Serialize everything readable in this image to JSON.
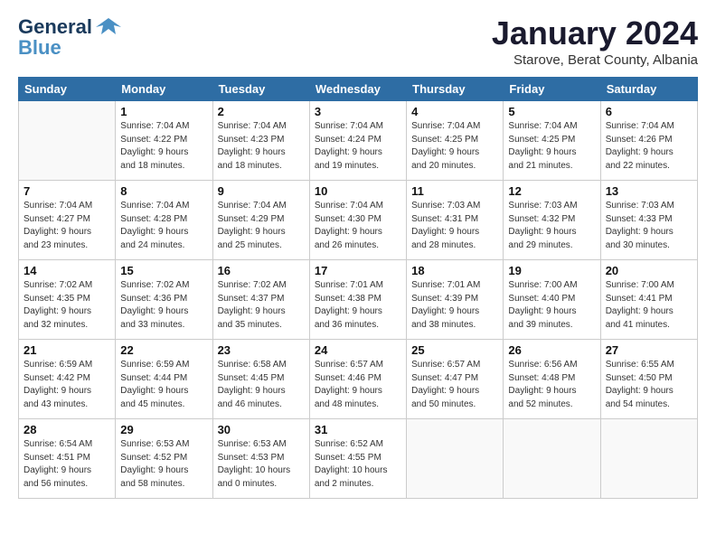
{
  "logo": {
    "line1": "General",
    "line2": "Blue"
  },
  "title": "January 2024",
  "subtitle": "Starove, Berat County, Albania",
  "weekdays": [
    "Sunday",
    "Monday",
    "Tuesday",
    "Wednesday",
    "Thursday",
    "Friday",
    "Saturday"
  ],
  "weeks": [
    [
      {
        "day": "",
        "info": ""
      },
      {
        "day": "1",
        "info": "Sunrise: 7:04 AM\nSunset: 4:22 PM\nDaylight: 9 hours\nand 18 minutes."
      },
      {
        "day": "2",
        "info": "Sunrise: 7:04 AM\nSunset: 4:23 PM\nDaylight: 9 hours\nand 18 minutes."
      },
      {
        "day": "3",
        "info": "Sunrise: 7:04 AM\nSunset: 4:24 PM\nDaylight: 9 hours\nand 19 minutes."
      },
      {
        "day": "4",
        "info": "Sunrise: 7:04 AM\nSunset: 4:25 PM\nDaylight: 9 hours\nand 20 minutes."
      },
      {
        "day": "5",
        "info": "Sunrise: 7:04 AM\nSunset: 4:25 PM\nDaylight: 9 hours\nand 21 minutes."
      },
      {
        "day": "6",
        "info": "Sunrise: 7:04 AM\nSunset: 4:26 PM\nDaylight: 9 hours\nand 22 minutes."
      }
    ],
    [
      {
        "day": "7",
        "info": "Sunrise: 7:04 AM\nSunset: 4:27 PM\nDaylight: 9 hours\nand 23 minutes."
      },
      {
        "day": "8",
        "info": "Sunrise: 7:04 AM\nSunset: 4:28 PM\nDaylight: 9 hours\nand 24 minutes."
      },
      {
        "day": "9",
        "info": "Sunrise: 7:04 AM\nSunset: 4:29 PM\nDaylight: 9 hours\nand 25 minutes."
      },
      {
        "day": "10",
        "info": "Sunrise: 7:04 AM\nSunset: 4:30 PM\nDaylight: 9 hours\nand 26 minutes."
      },
      {
        "day": "11",
        "info": "Sunrise: 7:03 AM\nSunset: 4:31 PM\nDaylight: 9 hours\nand 28 minutes."
      },
      {
        "day": "12",
        "info": "Sunrise: 7:03 AM\nSunset: 4:32 PM\nDaylight: 9 hours\nand 29 minutes."
      },
      {
        "day": "13",
        "info": "Sunrise: 7:03 AM\nSunset: 4:33 PM\nDaylight: 9 hours\nand 30 minutes."
      }
    ],
    [
      {
        "day": "14",
        "info": "Sunrise: 7:02 AM\nSunset: 4:35 PM\nDaylight: 9 hours\nand 32 minutes."
      },
      {
        "day": "15",
        "info": "Sunrise: 7:02 AM\nSunset: 4:36 PM\nDaylight: 9 hours\nand 33 minutes."
      },
      {
        "day": "16",
        "info": "Sunrise: 7:02 AM\nSunset: 4:37 PM\nDaylight: 9 hours\nand 35 minutes."
      },
      {
        "day": "17",
        "info": "Sunrise: 7:01 AM\nSunset: 4:38 PM\nDaylight: 9 hours\nand 36 minutes."
      },
      {
        "day": "18",
        "info": "Sunrise: 7:01 AM\nSunset: 4:39 PM\nDaylight: 9 hours\nand 38 minutes."
      },
      {
        "day": "19",
        "info": "Sunrise: 7:00 AM\nSunset: 4:40 PM\nDaylight: 9 hours\nand 39 minutes."
      },
      {
        "day": "20",
        "info": "Sunrise: 7:00 AM\nSunset: 4:41 PM\nDaylight: 9 hours\nand 41 minutes."
      }
    ],
    [
      {
        "day": "21",
        "info": "Sunrise: 6:59 AM\nSunset: 4:42 PM\nDaylight: 9 hours\nand 43 minutes."
      },
      {
        "day": "22",
        "info": "Sunrise: 6:59 AM\nSunset: 4:44 PM\nDaylight: 9 hours\nand 45 minutes."
      },
      {
        "day": "23",
        "info": "Sunrise: 6:58 AM\nSunset: 4:45 PM\nDaylight: 9 hours\nand 46 minutes."
      },
      {
        "day": "24",
        "info": "Sunrise: 6:57 AM\nSunset: 4:46 PM\nDaylight: 9 hours\nand 48 minutes."
      },
      {
        "day": "25",
        "info": "Sunrise: 6:57 AM\nSunset: 4:47 PM\nDaylight: 9 hours\nand 50 minutes."
      },
      {
        "day": "26",
        "info": "Sunrise: 6:56 AM\nSunset: 4:48 PM\nDaylight: 9 hours\nand 52 minutes."
      },
      {
        "day": "27",
        "info": "Sunrise: 6:55 AM\nSunset: 4:50 PM\nDaylight: 9 hours\nand 54 minutes."
      }
    ],
    [
      {
        "day": "28",
        "info": "Sunrise: 6:54 AM\nSunset: 4:51 PM\nDaylight: 9 hours\nand 56 minutes."
      },
      {
        "day": "29",
        "info": "Sunrise: 6:53 AM\nSunset: 4:52 PM\nDaylight: 9 hours\nand 58 minutes."
      },
      {
        "day": "30",
        "info": "Sunrise: 6:53 AM\nSunset: 4:53 PM\nDaylight: 10 hours\nand 0 minutes."
      },
      {
        "day": "31",
        "info": "Sunrise: 6:52 AM\nSunset: 4:55 PM\nDaylight: 10 hours\nand 2 minutes."
      },
      {
        "day": "",
        "info": ""
      },
      {
        "day": "",
        "info": ""
      },
      {
        "day": "",
        "info": ""
      }
    ]
  ]
}
